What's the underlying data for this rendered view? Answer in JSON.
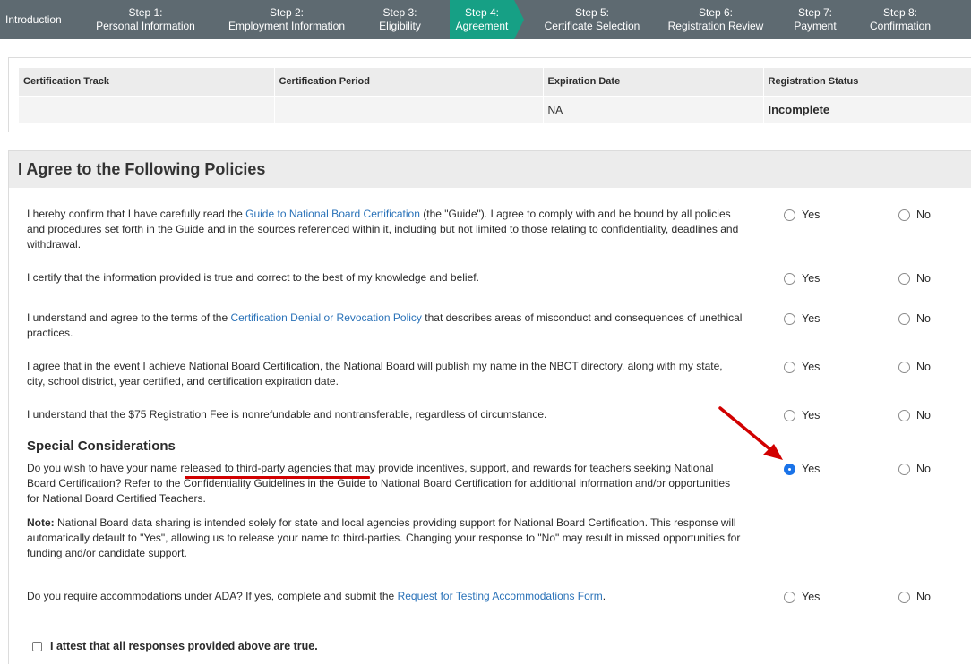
{
  "stepper": {
    "steps": [
      {
        "num": "",
        "label": "Introduction"
      },
      {
        "num": "Step 1:",
        "label": "Personal Information"
      },
      {
        "num": "Step 2:",
        "label": "Employment Information"
      },
      {
        "num": "Step 3:",
        "label": "Eligibility"
      },
      {
        "num": "Step 4:",
        "label": "Agreement"
      },
      {
        "num": "Step 5:",
        "label": "Certificate Selection"
      },
      {
        "num": "Step 6:",
        "label": "Registration Review"
      },
      {
        "num": "Step 7:",
        "label": "Payment"
      },
      {
        "num": "Step 8:",
        "label": "Confirmation"
      }
    ],
    "active_index": 4,
    "active_color": "#16a085",
    "bar_color": "#5e6a71"
  },
  "summary": {
    "headers": [
      "Certification Track",
      "Certification Period",
      "Expiration Date",
      "Registration Status"
    ],
    "values": [
      "",
      "",
      "NA",
      "Incomplete"
    ]
  },
  "policies": {
    "title": "I Agree to the Following Policies",
    "yes_label": "Yes",
    "no_label": "No",
    "items": [
      {
        "before": "I hereby confirm that I have carefully read the ",
        "link": "Guide to National Board Certification",
        "after": " (the \"Guide\"). I agree to comply with and be bound by all policies and procedures set forth in the Guide and in the sources referenced within it, including but not limited to those relating to confidentiality, deadlines and withdrawal.",
        "selected": ""
      },
      {
        "before": "I certify that the information provided is true and correct to the best of my knowledge and belief.",
        "link": "",
        "after": "",
        "selected": ""
      },
      {
        "before": "I understand and agree to the terms of the ",
        "link": "Certification Denial or Revocation Policy",
        "after": " that describes areas of misconduct and consequences of unethical practices.",
        "selected": ""
      },
      {
        "before": "I agree that in the event I achieve National Board Certification, the National Board will publish my name in the NBCT directory, along with my state, city, school district, year certified, and certification expiration date.",
        "link": "",
        "after": "",
        "selected": ""
      },
      {
        "before": "I understand that the $75 Registration Fee is nonrefundable and nontransferable, regardless of circumstance.",
        "link": "",
        "after": "",
        "selected": ""
      }
    ]
  },
  "special": {
    "title": "Special Considerations",
    "question": "Do you wish to have your name released to third-party agencies that may provide incentives, support, and rewards for teachers seeking National Board Certification? Refer to the Confidentiality Guidelines in the Guide to National Board Certification for additional information and/or opportunities for National Board Certified Teachers.",
    "note_label": "Note:",
    "note_text": " National Board data sharing is intended solely for state and local agencies providing support for National Board Certification. This response will automatically default to \"Yes\", allowing us to release your name to third-parties. Changing your response to \"No\" may result in missed opportunities for funding and/or candidate support.",
    "selected": "Yes"
  },
  "ada": {
    "before": "Do you require accommodations under ADA? If yes, complete and submit the ",
    "link": "Request for Testing Accommodations Form",
    "after": ".",
    "selected": ""
  },
  "attest": {
    "label": "I attest that all responses provided above are true.",
    "checked": false
  },
  "annotation_color": "#d10000"
}
